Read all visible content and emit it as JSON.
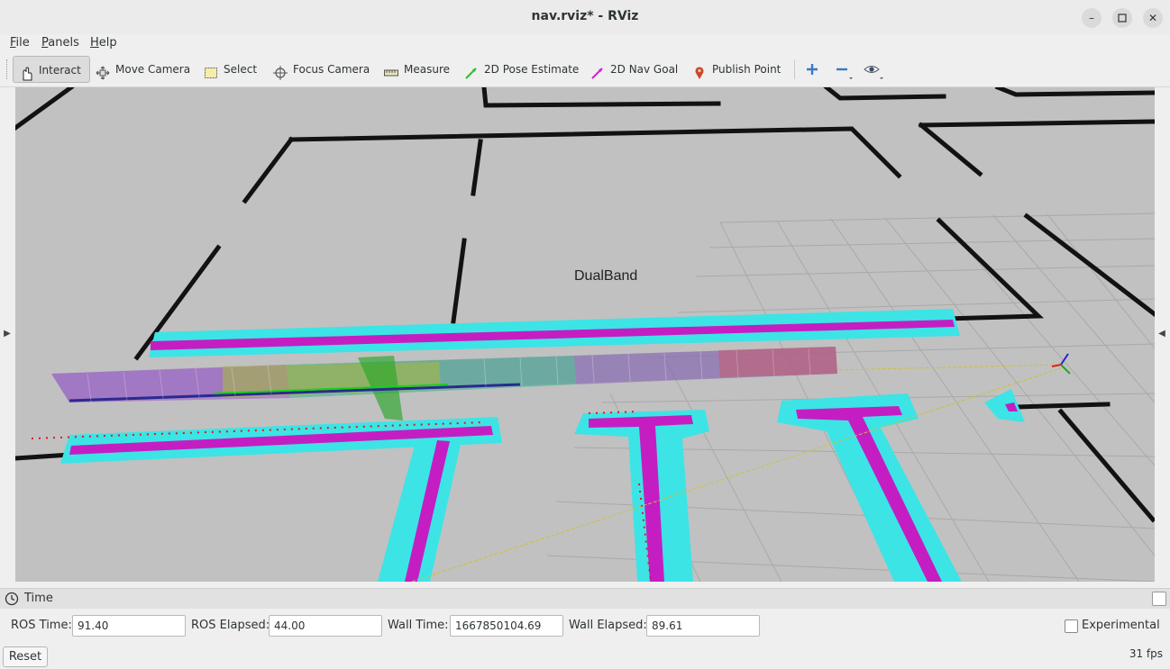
{
  "window": {
    "title": "nav.rviz* - RViz",
    "buttons": [
      "minimize-icon",
      "maximize-icon",
      "close-icon"
    ]
  },
  "menu": {
    "items": [
      {
        "label": "File",
        "mnemonic": "F",
        "rest": "ile"
      },
      {
        "label": "Panels",
        "mnemonic": "P",
        "rest": "anels"
      },
      {
        "label": "Help",
        "mnemonic": "H",
        "rest": "elp"
      }
    ]
  },
  "toolbar": {
    "tools": [
      {
        "label": "Interact",
        "icon": "hand-pointer-icon",
        "active": true
      },
      {
        "label": "Move Camera",
        "icon": "move-camera-icon",
        "active": false
      },
      {
        "label": "Select",
        "icon": "select-box-icon",
        "active": false
      },
      {
        "label": "Focus Camera",
        "icon": "focus-crosshair-icon",
        "active": false
      },
      {
        "label": "Measure",
        "icon": "ruler-icon",
        "active": false
      },
      {
        "label": "2D Pose Estimate",
        "icon": "green-arrow-icon",
        "active": false
      },
      {
        "label": "2D Nav Goal",
        "icon": "magenta-arrow-icon",
        "active": false
      },
      {
        "label": "Publish Point",
        "icon": "map-pin-icon",
        "active": false
      }
    ],
    "extra_icons": [
      "add-tool-icon",
      "remove-tool-icon",
      "view-eye-icon"
    ]
  },
  "viewport": {
    "label": "DualBand",
    "colors": {
      "floor": "#c1c1c1",
      "wall": "#111111",
      "inflation": "#39e3e3",
      "costmap": "#c81ec8",
      "path": "#1cd21c"
    }
  },
  "time_panel": {
    "title": "Time",
    "ros_time_label": "ROS Time:",
    "ros_time": "91.40",
    "ros_elapsed_label": "ROS Elapsed:",
    "ros_elapsed": "44.00",
    "wall_time_label": "Wall Time:",
    "wall_time": "1667850104.69",
    "wall_elapsed_label": "Wall Elapsed:",
    "wall_elapsed": "89.61",
    "experimental_label": "Experimental",
    "experimental_checked": false
  },
  "footer": {
    "reset_label": "Reset",
    "fps": "31 fps"
  }
}
